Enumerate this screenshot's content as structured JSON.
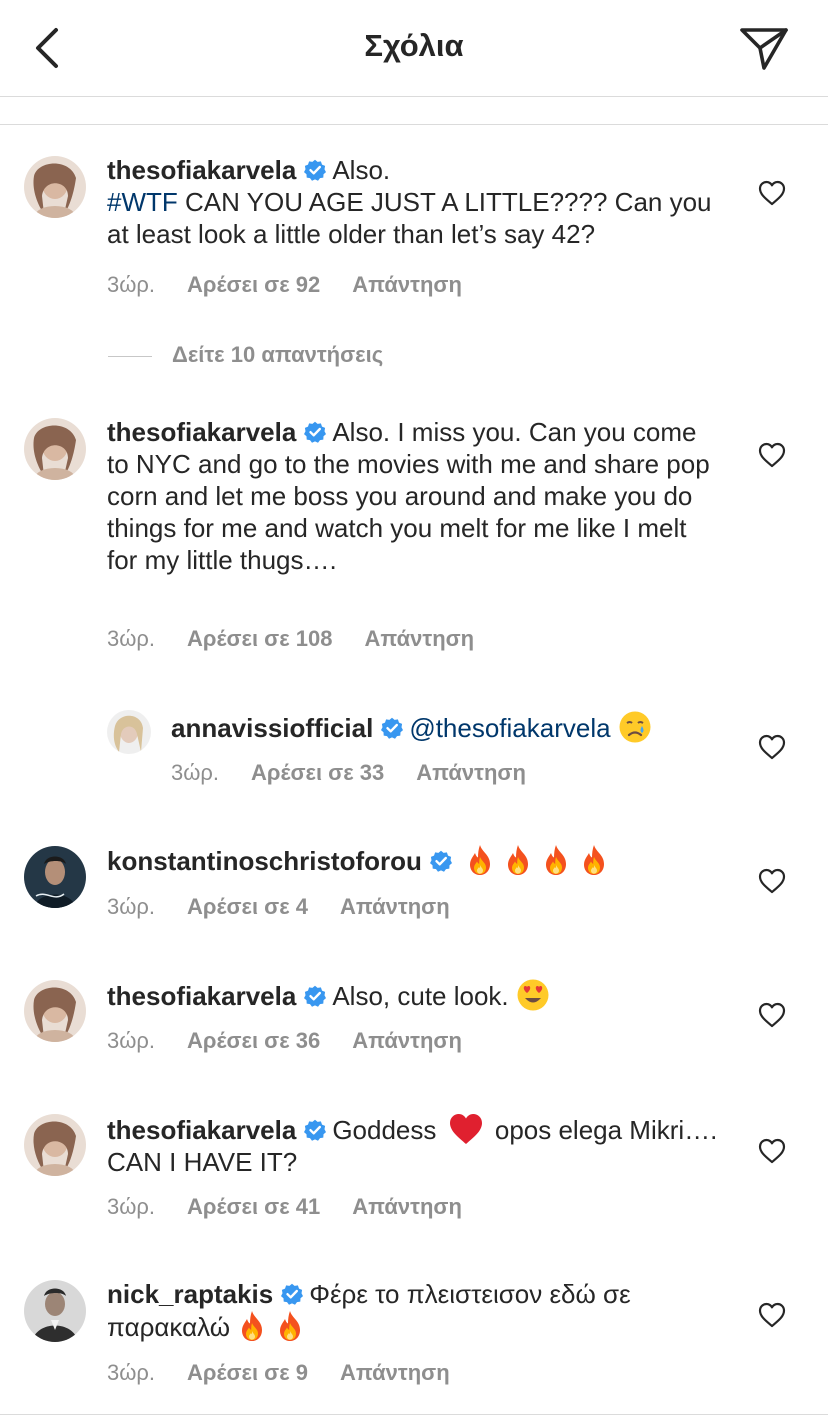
{
  "header": {
    "title": "Σχόλια"
  },
  "colors": {
    "link": "#00376b",
    "verified": "#3897f0",
    "meta": "#8e8e8e"
  },
  "labels": {
    "like_prefix": "Αρέσει σε",
    "reply": "Απάντηση"
  },
  "view_replies": "Δείτε 10 απαντήσεις",
  "comments": [
    {
      "username": "thesofiakarvela",
      "verified": true,
      "text_1": "Also.",
      "hashtag": "#WTF",
      "text_2": " CAN YOU AGE JUST A LITTLE???? Can you at least look a little older than let’s say 42?",
      "time": "3ώρ.",
      "likes": "Αρέσει σε 92",
      "reply": "Απάντηση"
    },
    {
      "username": "thesofiakarvela",
      "verified": true,
      "text": "Also. I miss you. Can you come to NYC and go to the movies with me and share pop corn and let me boss you around and make you do things for me and watch you melt for me like I melt for my little thugs….",
      "time": "3ώρ.",
      "likes": "Αρέσει σε 108",
      "reply": "Απάντηση"
    },
    {
      "username": "annavissiofficial",
      "verified": true,
      "mention": "@thesofiakarvela",
      "emoji": "crying-face",
      "time": "3ώρ.",
      "likes": "Αρέσει σε 33",
      "reply": "Απάντηση"
    },
    {
      "username": "konstantinoschristoforou",
      "verified": true,
      "emoji": "fire x4",
      "time": "3ώρ.",
      "likes": "Αρέσει σε 4",
      "reply": "Απάντηση"
    },
    {
      "username": "thesofiakarvela",
      "verified": true,
      "text": "Also, cute look.",
      "emoji": "heart-eyes",
      "time": "3ώρ.",
      "likes": "Αρέσει σε 36",
      "reply": "Απάντηση"
    },
    {
      "username": "thesofiakarvela",
      "verified": true,
      "text_1": "Goddess",
      "text_2": " opos elega Mikri…. CAN I HAVE IT?",
      "emoji": "red-heart",
      "time": "3ώρ.",
      "likes": "Αρέσει σε 41",
      "reply": "Απάντηση"
    },
    {
      "username": "nick_raptakis",
      "verified": true,
      "text": "Φέρε το πλειστεισον εδώ σε παρακαλώ",
      "emoji": "fire x2",
      "time": "3ώρ.",
      "likes": "Αρέσει σε 9",
      "reply": "Απάντηση"
    }
  ]
}
